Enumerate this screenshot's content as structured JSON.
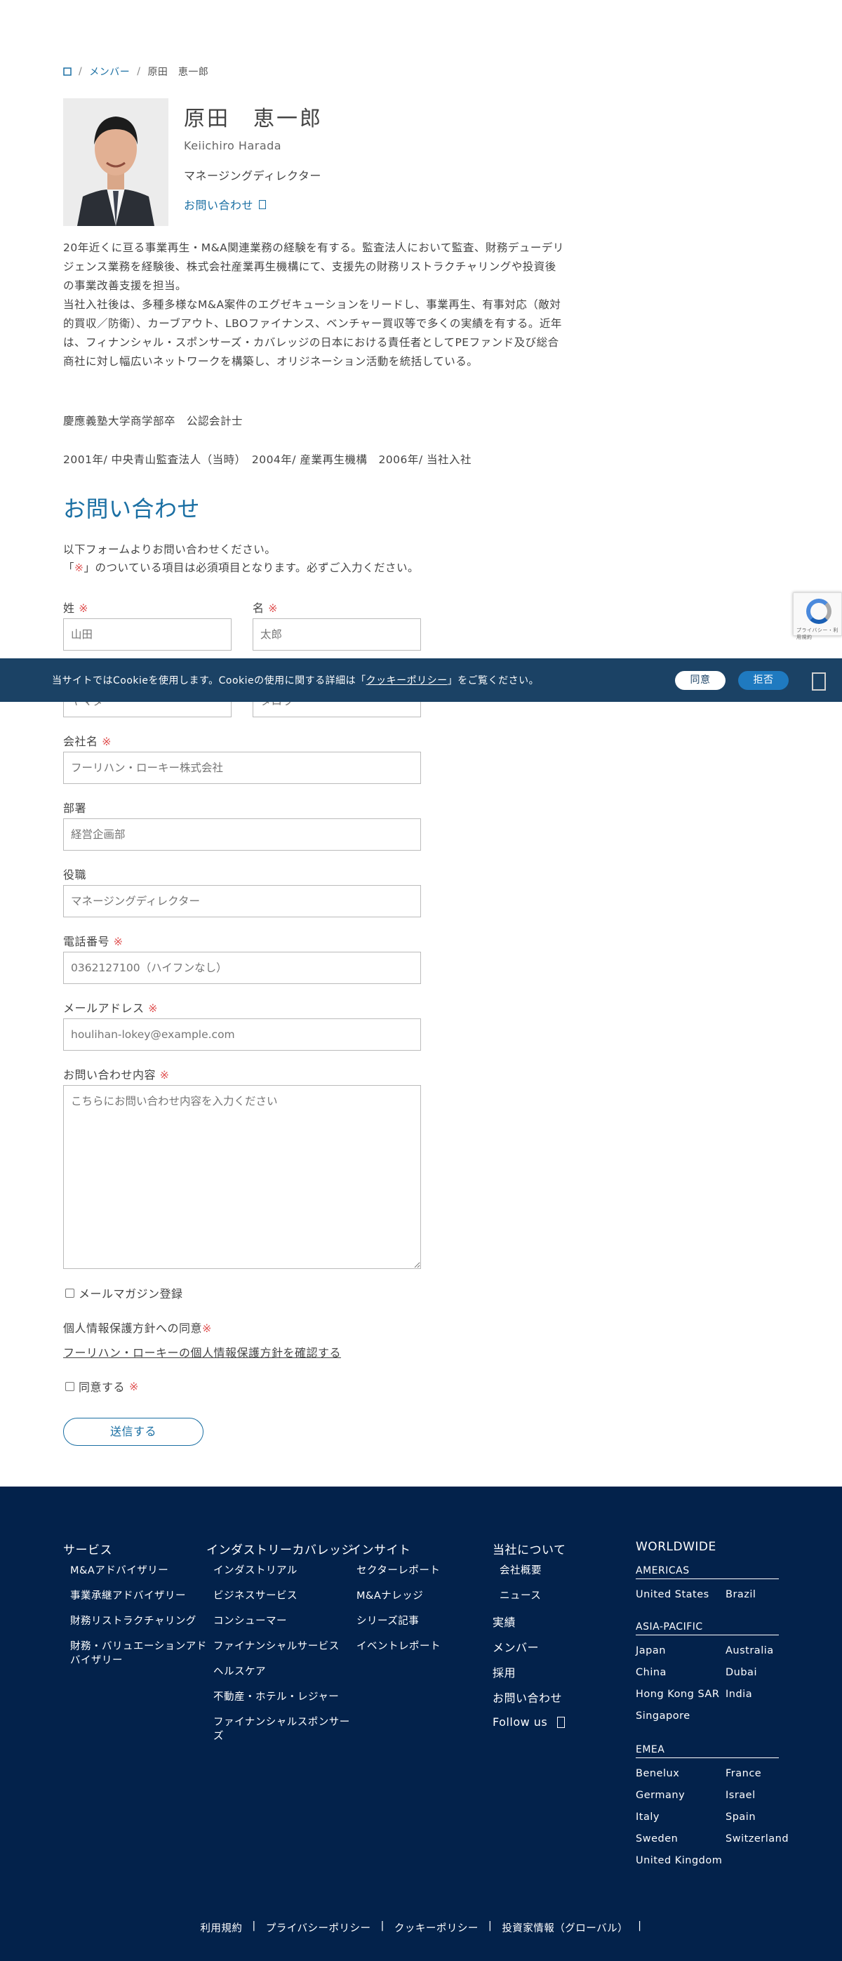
{
  "breadcrumb": {
    "members": "メンバー",
    "current": "原田　恵一郎",
    "sep": "/"
  },
  "profile": {
    "name": "原田　恵一郎",
    "english_name": "Keiichiro Harada",
    "title": "マネージングディレクター",
    "contact_link": "お問い合わせ"
  },
  "bio": {
    "p1": "20年近くに亘る事業再生・M&A関連業務の経験を有する。監査法人において監査、財務デューデリジェンス業務を経験後、株式会社産業再生機構にて、支援先の財務リストラクチャリングや投資後の事業改善支援を担当。",
    "p2": "当社入社後は、多種多様なM&A案件のエグゼキューションをリードし、事業再生、有事対応（敵対的買収／防衛）、カーブアウト、LBOファイナンス、ベンチャー買収等で多くの実績を有する。近年は、フィナンシャル・スポンサーズ・カバレッジの日本における責任者としてPEファンド及び総合商社に対し幅広いネットワークを構築し、オリジネーション活動を統括している。",
    "education": "慶應義塾大学商学部卒　公認会計士",
    "career": "2001年/ 中央青山監査法人（当時）　2004年/ 産業再生機構　2006年/ 当社入社"
  },
  "contact_form": {
    "heading": "お問い合わせ",
    "intro_line1": "以下フォームよりお問い合わせください。",
    "intro_line2_a": "「",
    "intro_line2_mark": "※",
    "intro_line2_b": "」のついている項目は必須項目となります。必ずご入力ください。",
    "required_mark": "※",
    "last_name_label": "姓",
    "last_name_placeholder": "山田",
    "first_name_label": "名",
    "first_name_placeholder": "太郎",
    "kana_last_placeholder": "ヤマダ",
    "kana_first_placeholder": "タロウ",
    "company_label": "会社名",
    "company_placeholder": "フーリハン・ローキー株式会社",
    "dept_label": "部署",
    "dept_placeholder": "経営企画部",
    "position_label": "役職",
    "position_placeholder": "マネージングディレクター",
    "phone_label": "電話番号",
    "phone_placeholder": "0362127100（ハイフンなし）",
    "email_label": "メールアドレス",
    "email_placeholder": "houlihan-lokey@example.com",
    "inquiry_label": "お問い合わせ内容",
    "inquiry_placeholder": "こちらにお問い合わせ内容を入力ください",
    "newsletter_label": "メールマガジン登録",
    "privacy_heading": "個人情報保護方針への同意",
    "privacy_link": "フーリハン・ローキーの個人情報保護方針を確認する",
    "agree_label": "同意する",
    "submit_label": "送信する"
  },
  "cookie_banner": {
    "text_before": "当サイトではCookieを使用します。Cookieの使用に関する詳細は「",
    "policy_link": "クッキーポリシー",
    "text_after": "」をご覧ください。",
    "agree": "同意",
    "reject": "拒否"
  },
  "recaptcha": {
    "text": "プライバシー・利用規約"
  },
  "footer": {
    "services": {
      "heading": "サービス",
      "items": [
        "M&Aアドバイザリー",
        "事業承継アドバイザリー",
        "財務リストラクチャリング",
        "財務・バリュエーションアドバイザリー"
      ]
    },
    "industry": {
      "heading": "インダストリーカバレッジ",
      "items": [
        "インダストリアル",
        "ビジネスサービス",
        "コンシューマー",
        "ファイナンシャルサービス",
        "ヘルスケア",
        "不動産・ホテル・レジャー",
        "ファイナンシャルスポンサーズ"
      ]
    },
    "insights": {
      "heading": "インサイト",
      "items": [
        "セクターレポート",
        "M&Aナレッジ",
        "シリーズ記事",
        "イベントレポート"
      ]
    },
    "about": {
      "heading": "当社について",
      "items": [
        "会社概要",
        "ニュース"
      ],
      "links": [
        "実績",
        "メンバー",
        "採用",
        "お問い合わせ"
      ],
      "follow": "Follow us"
    },
    "worldwide": {
      "heading": "WORLDWIDE",
      "americas": {
        "label": "AMERICAS",
        "items": [
          "United States",
          "Brazil"
        ]
      },
      "apac": {
        "label": "ASIA-PACIFIC",
        "items": [
          "Japan",
          "Australia",
          "China",
          "Dubai",
          "Hong Kong SAR",
          "India",
          "Singapore"
        ]
      },
      "emea": {
        "label": "EMEA",
        "items": [
          "Benelux",
          "France",
          "Germany",
          "Israel",
          "Italy",
          "Spain",
          "Sweden",
          "Switzerland",
          "United Kingdom"
        ]
      }
    },
    "bottom_links": [
      "利用規約",
      "プライバシーポリシー",
      "クッキーポリシー",
      "投資家情報（グローバル）"
    ],
    "bottom_sep": "|"
  }
}
